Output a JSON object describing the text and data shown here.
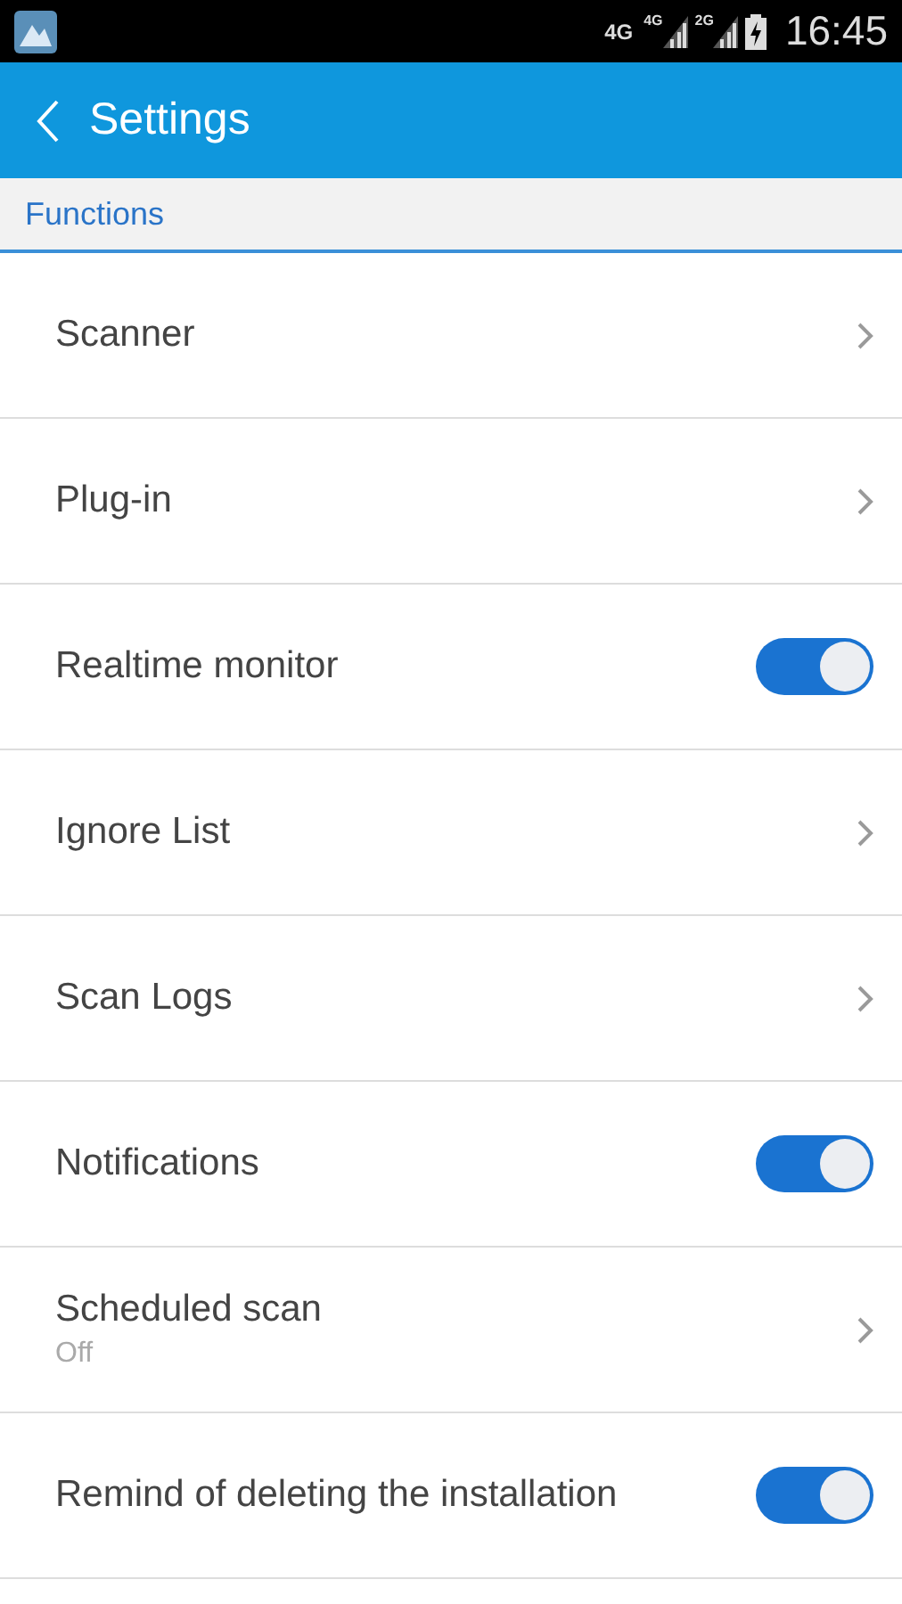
{
  "status_bar": {
    "network": "4G",
    "sims": [
      {
        "label": "4G"
      },
      {
        "label": "2G"
      }
    ],
    "time": "16:45"
  },
  "header": {
    "title": "Settings"
  },
  "section": {
    "title": "Functions"
  },
  "rows": [
    {
      "kind": "link",
      "label": "Scanner"
    },
    {
      "kind": "link",
      "label": "Plug-in"
    },
    {
      "kind": "toggle",
      "label": "Realtime monitor",
      "on": true
    },
    {
      "kind": "link",
      "label": "Ignore List"
    },
    {
      "kind": "link",
      "label": "Scan Logs"
    },
    {
      "kind": "toggle",
      "label": "Notifications",
      "on": true
    },
    {
      "kind": "link",
      "label": "Scheduled scan",
      "subtitle": "Off"
    },
    {
      "kind": "toggle",
      "label": "Remind of deleting the installation",
      "on": true
    }
  ]
}
